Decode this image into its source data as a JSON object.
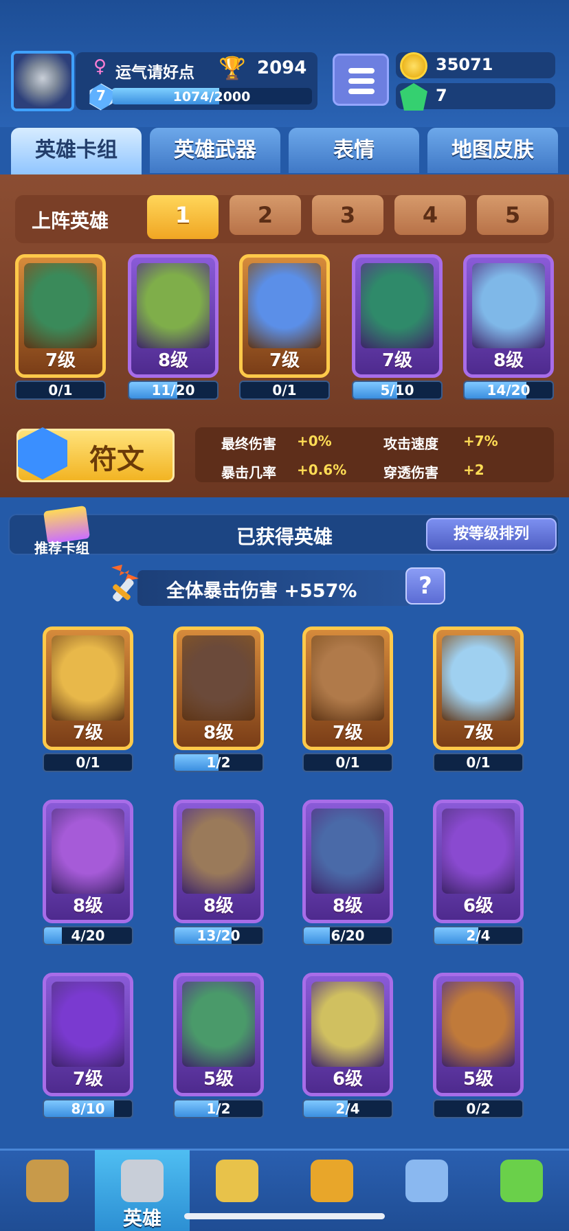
{
  "player": {
    "name": "运气请好点",
    "trophies": "2094",
    "level": "7",
    "xp_text": "1074/2000",
    "xp_fraction": 0.537
  },
  "currency": {
    "coins": "35071",
    "gems": "7"
  },
  "tabs": [
    {
      "label": "英雄卡组",
      "active": true
    },
    {
      "label": "英雄武器",
      "active": false
    },
    {
      "label": "表情",
      "active": false
    },
    {
      "label": "地图皮肤",
      "active": false
    }
  ],
  "deck": {
    "label": "上阵英雄",
    "slots": [
      "1",
      "2",
      "3",
      "4",
      "5"
    ],
    "selected_slot": "1",
    "cards": [
      {
        "level": "7级",
        "progress": "0/1",
        "fraction": 0,
        "rarity": "gold",
        "color": "#3a8a5a"
      },
      {
        "level": "8级",
        "progress": "11/20",
        "fraction": 0.55,
        "rarity": "purple",
        "color": "#7fae4a"
      },
      {
        "level": "7级",
        "progress": "0/1",
        "fraction": 0,
        "rarity": "gold",
        "color": "#5b8fe8"
      },
      {
        "level": "7级",
        "progress": "5/10",
        "fraction": 0.5,
        "rarity": "purple",
        "color": "#2f8a6a"
      },
      {
        "level": "8级",
        "progress": "14/20",
        "fraction": 0.7,
        "rarity": "purple",
        "color": "#7fb8e8"
      }
    ]
  },
  "rune": {
    "label": "符文",
    "stats": [
      {
        "label": "最终伤害",
        "value": "+0%"
      },
      {
        "label": "攻击速度",
        "value": "+7%"
      },
      {
        "label": "暴击几率",
        "value": "+0.6%"
      },
      {
        "label": "穿透伤害",
        "value": "+2"
      }
    ]
  },
  "collection": {
    "recommended_label": "推荐卡组",
    "title": "已获得英雄",
    "sort_label": "按等级排列",
    "crit_bonus": "全体暴击伤害 +557%",
    "help": "?",
    "cards": [
      {
        "level": "7级",
        "progress": "0/1",
        "fraction": 0,
        "rarity": "gold",
        "color": "#e8b84a"
      },
      {
        "level": "8级",
        "progress": "1/2",
        "fraction": 0.5,
        "rarity": "gold",
        "color": "#6b4a3a"
      },
      {
        "level": "7级",
        "progress": "0/1",
        "fraction": 0,
        "rarity": "gold",
        "color": "#b07a4a"
      },
      {
        "level": "7级",
        "progress": "0/1",
        "fraction": 0,
        "rarity": "gold",
        "color": "#9fd0f0"
      },
      {
        "level": "8级",
        "progress": "4/20",
        "fraction": 0.2,
        "rarity": "purple",
        "color": "#a65bd8"
      },
      {
        "level": "8级",
        "progress": "13/20",
        "fraction": 0.65,
        "rarity": "purple",
        "color": "#9a7a5a"
      },
      {
        "level": "8级",
        "progress": "6/20",
        "fraction": 0.3,
        "rarity": "purple",
        "color": "#4a6aa8"
      },
      {
        "level": "6级",
        "progress": "2/4",
        "fraction": 0.5,
        "rarity": "purple",
        "color": "#8a4ad0"
      },
      {
        "level": "7级",
        "progress": "8/10",
        "fraction": 0.8,
        "rarity": "purple",
        "color": "#7a3ad0"
      },
      {
        "level": "5级",
        "progress": "1/2",
        "fraction": 0.5,
        "rarity": "purple",
        "color": "#4a9a6a"
      },
      {
        "level": "6级",
        "progress": "2/4",
        "fraction": 0.5,
        "rarity": "purple",
        "color": "#d0c060"
      },
      {
        "level": "5级",
        "progress": "0/2",
        "fraction": 0,
        "rarity": "purple",
        "color": "#c07a3a"
      }
    ]
  },
  "nav": [
    {
      "label": "",
      "icon": "treasure-chest-icon",
      "active": false
    },
    {
      "label": "英雄",
      "icon": "knight-helmet-icon",
      "active": true
    },
    {
      "label": "",
      "icon": "crossed-swords-icon",
      "active": false
    },
    {
      "label": "",
      "icon": "crown-shield-icon",
      "active": false
    },
    {
      "label": "",
      "icon": "friends-banner-icon",
      "active": false
    },
    {
      "label": "",
      "icon": "sprout-island-icon",
      "active": false
    }
  ]
}
